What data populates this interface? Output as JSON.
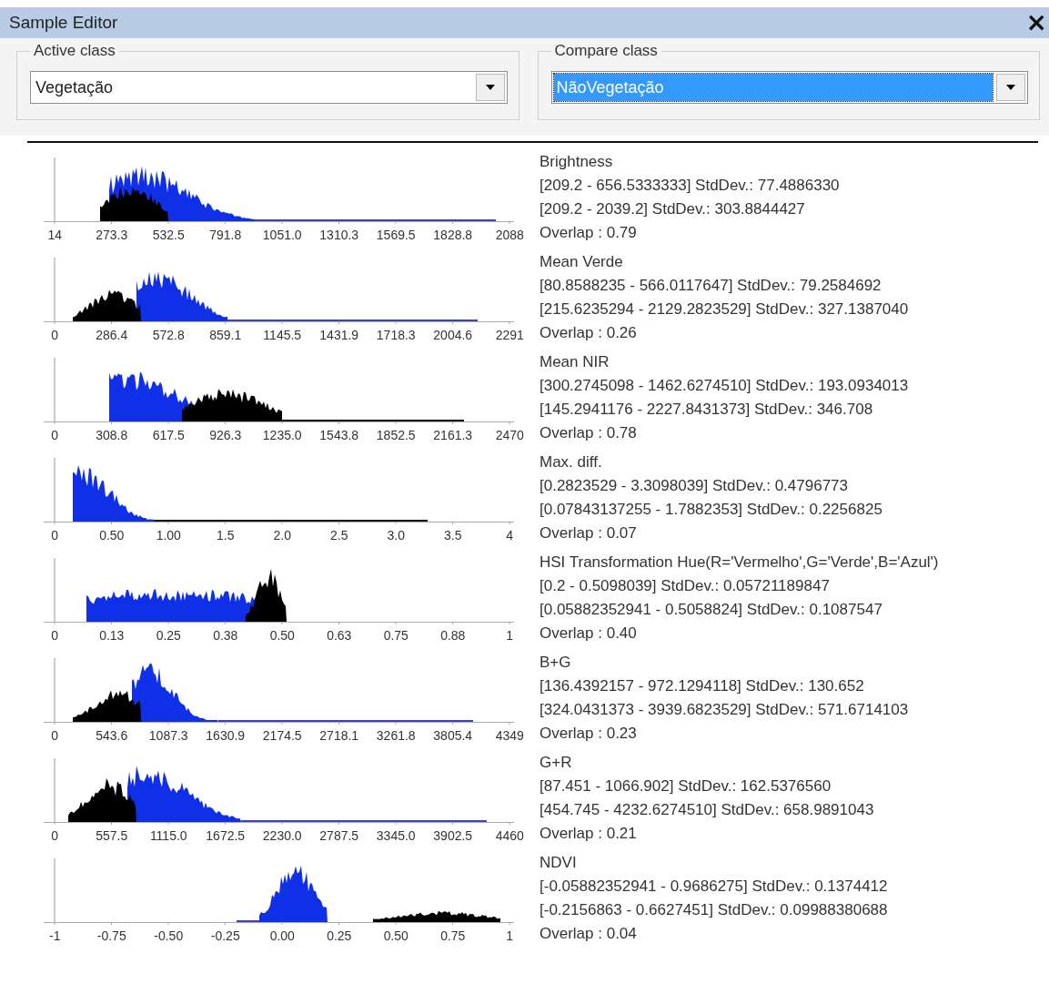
{
  "window": {
    "title": "Sample Editor",
    "close": "×"
  },
  "active_class": {
    "label": "Active class",
    "value": "Vegetação",
    "highlighted": false
  },
  "compare_class": {
    "label": "Compare class",
    "value": "NãoVegetação",
    "highlighted": true
  },
  "features": [
    {
      "name": "Brightness",
      "active_range": "[209.2 - 656.5333333] StdDev.: 77.4886330",
      "compare_range": "[209.2 - 2039.2] StdDev.: 303.8844427",
      "overlap": "Overlap : 0.79",
      "ticks": [
        "14",
        "273.3",
        "532.5",
        "791.8",
        "1051.0",
        "1310.3",
        "1569.5",
        "1828.8",
        "2088"
      ]
    },
    {
      "name": "Mean Verde",
      "active_range": "[80.8588235 - 566.0117647] StdDev.: 79.2584692",
      "compare_range": "[215.6235294 - 2129.2823529] StdDev.: 327.1387040",
      "overlap": "Overlap : 0.26",
      "ticks": [
        "0",
        "286.4",
        "572.8",
        "859.1",
        "1145.5",
        "1431.9",
        "1718.3",
        "2004.6",
        "2291"
      ]
    },
    {
      "name": "Mean NIR",
      "active_range": "[300.2745098 - 1462.6274510] StdDev.: 193.0934013",
      "compare_range": "[145.2941176 - 2227.8431373] StdDev.: 346.708",
      "overlap": "Overlap : 0.78",
      "ticks": [
        "0",
        "308.8",
        "617.5",
        "926.3",
        "1235.0",
        "1543.8",
        "1852.5",
        "2161.3",
        "2470"
      ]
    },
    {
      "name": "Max. diff.",
      "active_range": "[0.2823529 - 3.3098039] StdDev.: 0.4796773",
      "compare_range": "[0.07843137255 - 1.7882353] StdDev.: 0.2256825",
      "overlap": "Overlap : 0.07",
      "ticks": [
        "0",
        "0.50",
        "1.00",
        "1.5",
        "2.0",
        "2.5",
        "3.0",
        "3.5",
        "4"
      ]
    },
    {
      "name": "HSI Transformation Hue(R='Vermelho',G='Verde',B='Azul')",
      "active_range": "[0.2 - 0.5098039] StdDev.: 0.05721189847",
      "compare_range": "[0.05882352941 - 0.5058824] StdDev.: 0.1087547",
      "overlap": "Overlap : 0.40",
      "ticks": [
        "0",
        "0.13",
        "0.25",
        "0.38",
        "0.50",
        "0.63",
        "0.75",
        "0.88",
        "1"
      ]
    },
    {
      "name": "B+G",
      "active_range": "[136.4392157 - 972.1294118] StdDev.: 130.652",
      "compare_range": "[324.0431373 - 3939.6823529] StdDev.: 571.6714103",
      "overlap": "Overlap : 0.23",
      "ticks": [
        "0",
        "543.6",
        "1087.3",
        "1630.9",
        "2174.5",
        "2718.1",
        "3261.8",
        "3805.4",
        "4349"
      ]
    },
    {
      "name": "G+R",
      "active_range": "[87.451 - 1066.902] StdDev.: 162.5376560",
      "compare_range": "[454.745 - 4232.6274510] StdDev.: 658.9891043",
      "overlap": "Overlap : 0.21",
      "ticks": [
        "0",
        "557.5",
        "1115.0",
        "1672.5",
        "2230.0",
        "2787.5",
        "3345.0",
        "3902.5",
        "4460"
      ]
    },
    {
      "name": "NDVI",
      "active_range": "[-0.05882352941 - 0.9686275] StdDev.: 0.1374412",
      "compare_range": "[-0.2156863 - 0.6627451] StdDev.: 0.09988380688",
      "overlap": "Overlap : 0.04",
      "ticks": [
        "-1",
        "-0.75",
        "-0.50",
        "-0.25",
        "0.00",
        "0.25",
        "0.50",
        "0.75",
        "1"
      ]
    }
  ]
}
